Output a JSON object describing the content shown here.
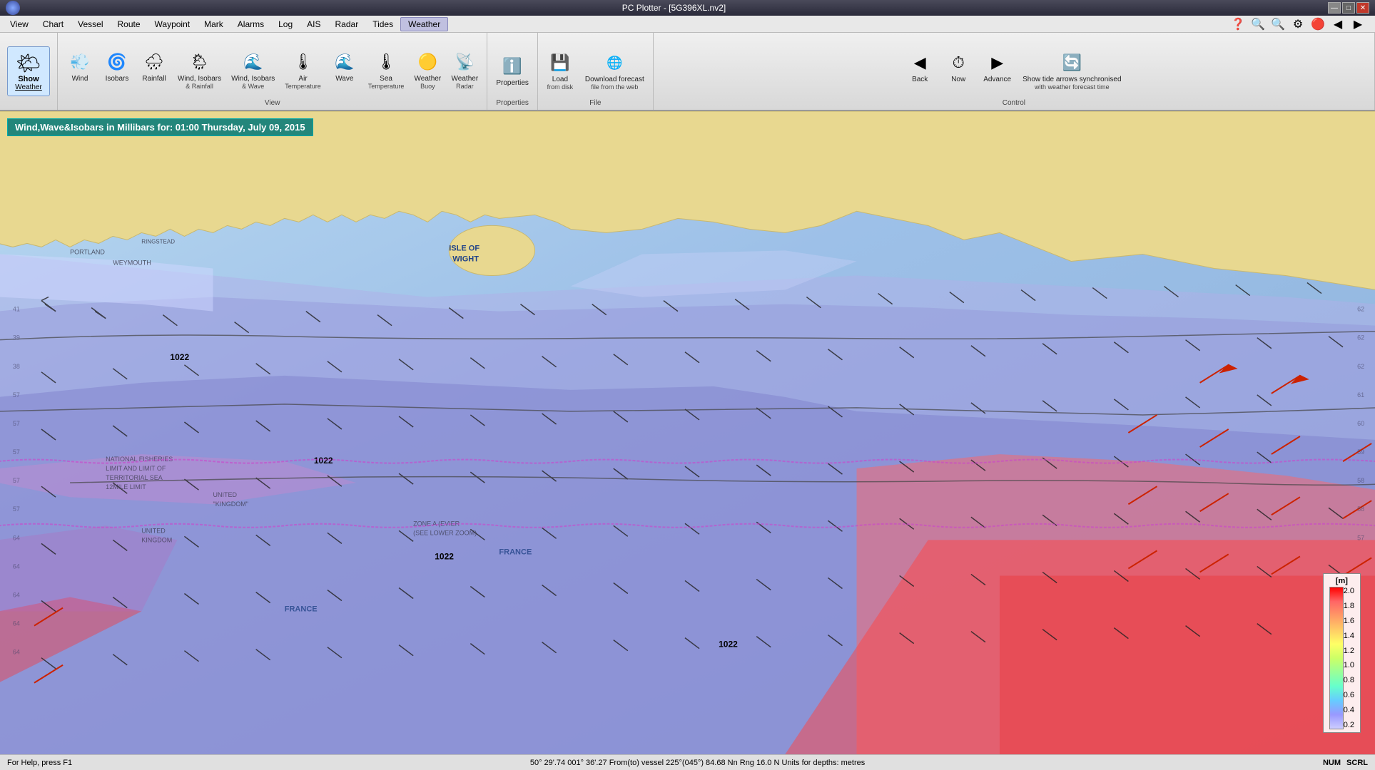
{
  "titleBar": {
    "title": "PC Plotter - [5G396XL.nv2]",
    "minimizeLabel": "—",
    "maximizeLabel": "□",
    "closeLabel": "✕"
  },
  "menuBar": {
    "items": [
      {
        "label": "View",
        "active": false
      },
      {
        "label": "Chart",
        "active": false
      },
      {
        "label": "Vessel",
        "active": false
      },
      {
        "label": "Route",
        "active": false
      },
      {
        "label": "Waypoint",
        "active": false
      },
      {
        "label": "Mark",
        "active": false
      },
      {
        "label": "Alarms",
        "active": false
      },
      {
        "label": "Log",
        "active": false
      },
      {
        "label": "AIS",
        "active": false
      },
      {
        "label": "Radar",
        "active": false
      },
      {
        "label": "Tides",
        "active": false
      },
      {
        "label": "Weather",
        "active": true
      }
    ]
  },
  "toolbar": {
    "groups": [
      {
        "name": "show-weather",
        "buttons": [
          {
            "id": "show-weather",
            "icon": "🌤",
            "label": "Show",
            "sublabel": "Weather",
            "active": true
          }
        ]
      },
      {
        "name": "view",
        "groupLabel": "View",
        "buttons": [
          {
            "id": "wind",
            "icon": "💨",
            "label": "Wind",
            "sublabel": "",
            "active": false
          },
          {
            "id": "isobars",
            "icon": "🌀",
            "label": "Isobars",
            "sublabel": "",
            "active": false
          },
          {
            "id": "rainfall",
            "icon": "🌧",
            "label": "Rainfall",
            "sublabel": "",
            "active": false
          },
          {
            "id": "wind-isobars-rainfall",
            "icon": "🌦",
            "label": "Wind, Isobars",
            "sublabel": "& Rainfall",
            "active": false
          },
          {
            "id": "wind-isobars-wave",
            "icon": "🌊",
            "label": "Wind, Isobars",
            "sublabel": "& Wave",
            "active": false
          },
          {
            "id": "air-temperature",
            "icon": "🌡",
            "label": "Air",
            "sublabel": "Temperature",
            "active": false
          },
          {
            "id": "wave",
            "icon": "🌊",
            "label": "Wave",
            "sublabel": "",
            "active": false
          },
          {
            "id": "sea-temperature",
            "icon": "🌡",
            "label": "Sea",
            "sublabel": "Temperature",
            "active": false
          },
          {
            "id": "weather-buoy",
            "icon": "🔴",
            "label": "Weather",
            "sublabel": "Buoy",
            "active": false
          },
          {
            "id": "weather-radar",
            "icon": "📡",
            "label": "Weather",
            "sublabel": "Radar",
            "active": false
          }
        ]
      },
      {
        "name": "properties",
        "groupLabel": "Properties",
        "buttons": [
          {
            "id": "properties",
            "icon": "ℹ",
            "label": "Properties",
            "sublabel": "",
            "active": false
          }
        ]
      },
      {
        "name": "file",
        "groupLabel": "File",
        "buttons": [
          {
            "id": "load-disk",
            "icon": "💾",
            "label": "Load",
            "sublabel": "from disk",
            "active": false
          },
          {
            "id": "download-forecast",
            "icon": "🌐",
            "label": "Download forecast",
            "sublabel": "file from the web",
            "active": false
          }
        ]
      },
      {
        "name": "control",
        "groupLabel": "Control",
        "buttons": [
          {
            "id": "back",
            "icon": "◀",
            "label": "Back",
            "sublabel": "",
            "active": false
          },
          {
            "id": "now",
            "icon": "⏱",
            "label": "Now",
            "sublabel": "",
            "active": false
          },
          {
            "id": "advance",
            "icon": "▶",
            "label": "Advance",
            "sublabel": "",
            "active": false
          },
          {
            "id": "show-tide-arrows",
            "icon": "🔄",
            "label": "Show tide arrows synchronised",
            "sublabel": "with weather forecast time",
            "active": false
          }
        ]
      }
    ],
    "rightIcons": [
      "❓",
      "🔍",
      "🔍",
      "⚙",
      "🔴",
      "◀",
      "▶"
    ]
  },
  "map": {
    "weatherInfo": "Wind,Wave&Isobars in Millibars for: 01:00 Thursday, July 09, 2015",
    "isobarLabels": [
      "1022",
      "1022",
      "1022",
      "1022"
    ],
    "colorScale": {
      "title": "[m]",
      "values": [
        "2.0",
        "1.8",
        "1.6",
        "1.4",
        "1.2",
        "1.0",
        "0.8",
        "0.6",
        "0.4",
        "0.2"
      ]
    }
  },
  "statusBar": {
    "helpText": "For Help, press F1",
    "coords": "50° 29'.74 001° 36'.27 From(to) vessel 225°(045°) 84.68 Nn Rng 16.0 N Units for depths: metres",
    "numLabel": "NUM",
    "scrollLabel": "SCRL"
  }
}
